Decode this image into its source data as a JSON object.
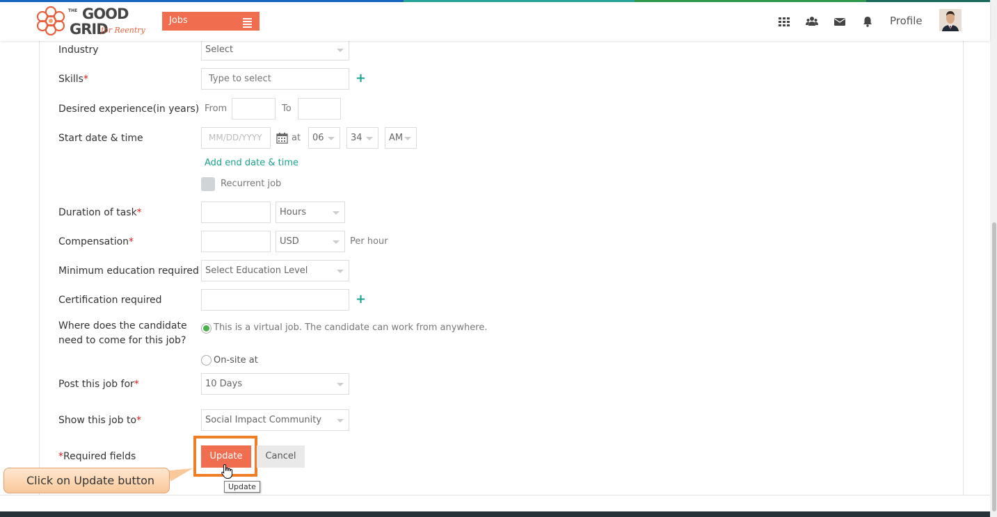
{
  "header": {
    "logo_line1": "GOOD",
    "logo_line2": "GRID",
    "logo_the": "THE",
    "logo_tagline": "for Reentry",
    "jobs_label": "Jobs",
    "profile_label": "Profile",
    "icons": [
      "apps-grid-icon",
      "users-icon",
      "mail-icon",
      "bell-icon"
    ]
  },
  "form": {
    "industry": {
      "label": "Industry",
      "value": "Select"
    },
    "skills": {
      "label": "Skills",
      "placeholder": "Type to select"
    },
    "experience": {
      "label": "Desired experience(in years)",
      "from": "From",
      "to": "To"
    },
    "start": {
      "label": "Start date & time",
      "date_placeholder": "MM/DD/YYYY",
      "at": "at",
      "hour": "06",
      "minute": "34",
      "ampm": "AM"
    },
    "add_end_link": "Add end date & time",
    "recurrent_label": "Recurrent job",
    "duration": {
      "label": "Duration of task",
      "unit": "Hours"
    },
    "compensation": {
      "label": "Compensation",
      "currency": "USD",
      "per": "Per hour"
    },
    "education": {
      "label": "Minimum education required",
      "value": "Select Education Level"
    },
    "certification": {
      "label": "Certification required"
    },
    "location": {
      "label_line1": "Where does the candidate",
      "label_line2": "need to come for this job?",
      "virtual_option": "This is a virtual job. The candidate can work from anywhere.",
      "onsite_option": "On-site at"
    },
    "post_for": {
      "label": "Post this job for",
      "value": "10 Days"
    },
    "show_to": {
      "label": "Show this job to",
      "value": "Social Impact Community"
    },
    "required_note": "Required fields",
    "required_mark": "*",
    "update_label": "Update",
    "cancel_label": "Cancel"
  },
  "overlay": {
    "callout_text": "Click on Update button",
    "tooltip_text": "Update"
  },
  "colors": {
    "accent": "#f06e4f",
    "teal": "#1aa38a",
    "highlight": "#f07e26",
    "footer": "#263238"
  }
}
